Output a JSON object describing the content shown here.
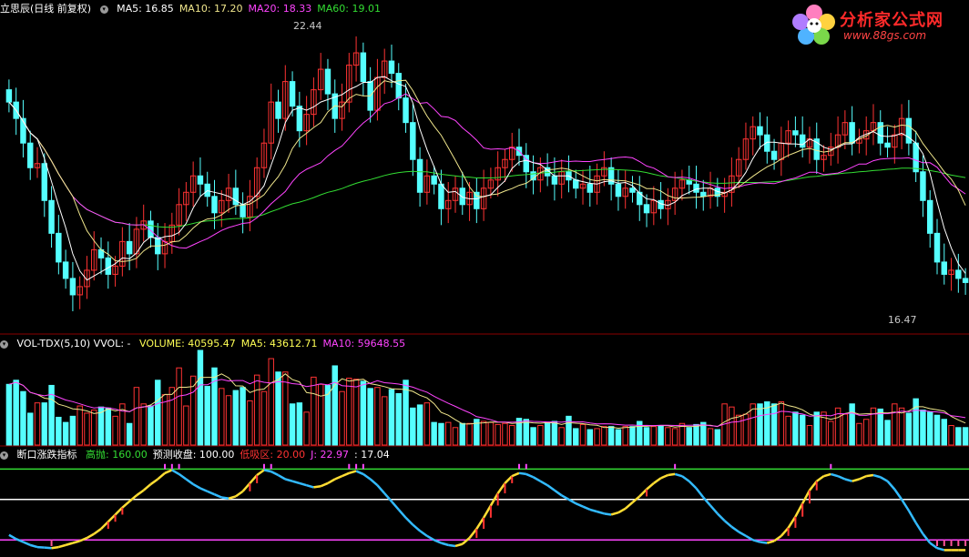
{
  "price_panel": {
    "title": "立思辰(日线 前复权)",
    "indicators": [
      {
        "label": "MA5: 16.85",
        "color": "#ffffff"
      },
      {
        "label": "MA10: 17.20",
        "color": "#f0e68c"
      },
      {
        "label": "MA20: 18.33",
        "color": "#ff44ff"
      },
      {
        "label": "MA60: 19.01",
        "color": "#33dd33"
      }
    ],
    "high_label": "22.44",
    "low_label": "16.47"
  },
  "volume_panel": {
    "title": "VOL-TDX(5,10) VVOL: -",
    "indicators": [
      {
        "label": "VOLUME: 40595.47",
        "color": "#ffff55"
      },
      {
        "label": "MA5: 43612.71",
        "color": "#ffff55"
      },
      {
        "label": "MA10: 59648.55",
        "color": "#ff44ff"
      }
    ]
  },
  "oscillator_panel": {
    "title": "断口涨跌指标",
    "indicators": [
      {
        "label": "高抛: 160.00",
        "color": "#33dd33"
      },
      {
        "label": "预测收盘: 100.00",
        "color": "#ffffff"
      },
      {
        "label": "低吸区: 20.00",
        "color": "#ff3333"
      },
      {
        "label": "J: 22.97",
        "color": "#ff44ff"
      },
      {
        "label": ": 17.04",
        "color": "#ffffff"
      }
    ]
  },
  "logo": {
    "brand": "分析家公式网",
    "url": "www.88gs.com"
  },
  "colors": {
    "up": "#ff3333",
    "down": "#55ffff",
    "ma5": "#ffffff",
    "ma10": "#f0e68c",
    "ma20": "#ff44ff",
    "ma60": "#33dd33",
    "divider": "#8b0000"
  },
  "chart_data": {
    "type": "candlestick",
    "closes": [
      21.0,
      20.6,
      20.0,
      19.4,
      19.5,
      18.6,
      17.8,
      17.1,
      16.7,
      16.3,
      16.5,
      16.9,
      17.4,
      17.2,
      16.8,
      17.0,
      17.6,
      17.3,
      17.9,
      18.1,
      17.7,
      17.3,
      17.6,
      18.0,
      18.5,
      18.8,
      19.2,
      19.0,
      18.7,
      18.3,
      18.6,
      18.9,
      18.5,
      18.2,
      18.7,
      19.4,
      20.0,
      21.0,
      20.6,
      21.5,
      20.9,
      20.3,
      20.7,
      21.3,
      21.8,
      21.2,
      20.6,
      21.0,
      21.9,
      22.2,
      21.5,
      20.8,
      21.6,
      22.0,
      21.7,
      21.1,
      20.5,
      19.6,
      18.8,
      19.2,
      19.0,
      18.4,
      18.6,
      18.9,
      18.5,
      18.8,
      18.4,
      18.9,
      19.1,
      19.4,
      19.6,
      19.9,
      19.7,
      19.3,
      19.1,
      19.4,
      19.2,
      19.0,
      19.3,
      19.1,
      18.9,
      19.0,
      18.8,
      19.2,
      19.4,
      19.0,
      18.7,
      18.9,
      18.8,
      18.5,
      18.3,
      18.6,
      18.4,
      18.6,
      18.9,
      19.1,
      19.0,
      18.8,
      18.7,
      18.9,
      18.7,
      18.8,
      19.2,
      19.6,
      20.1,
      20.4,
      20.2,
      19.8,
      19.6,
      20.0,
      20.3,
      20.2,
      19.9,
      20.1,
      19.6,
      19.7,
      19.9,
      20.2,
      20.5,
      20.0,
      20.1,
      20.3,
      20.5,
      20.0,
      19.9,
      20.2,
      20.6,
      20.0,
      19.3,
      18.6,
      17.8,
      17.1,
      16.8,
      16.9,
      16.7,
      16.6
    ],
    "ma5": [
      21.0,
      20.8,
      20.53,
      20.25,
      20.1,
      19.62,
      19.06,
      18.48,
      17.94,
      17.3,
      16.88,
      16.66,
      16.76,
      16.86,
      16.96,
      17.06,
      17.2,
      17.18,
      17.32,
      17.58,
      17.72,
      17.66,
      17.72,
      17.74,
      17.82,
      18.04,
      18.42,
      18.7,
      18.84,
      18.8,
      18.76,
      18.7,
      18.6,
      18.5,
      18.58,
      18.74,
      18.96,
      19.46,
      19.94,
      20.5,
      20.8,
      20.86,
      20.8,
      20.88,
      21.0,
      21.06,
      21.12,
      21.18,
      21.3,
      21.38,
      21.48,
      21.48,
      21.6,
      21.62,
      21.52,
      21.44,
      21.38,
      20.98,
      20.34,
      19.84,
      19.42,
      19.0,
      18.8,
      18.82,
      18.68,
      18.64,
      18.64,
      18.7,
      18.74,
      18.92,
      19.08,
      19.38,
      19.54,
      19.58,
      19.52,
      19.48,
      19.34,
      19.2,
      19.2,
      19.2,
      19.1,
      19.06,
      19.02,
      19.0,
      19.06,
      19.08,
      19.02,
      19.04,
      18.96,
      18.78,
      18.64,
      18.62,
      18.52,
      18.48,
      18.56,
      18.72,
      18.8,
      18.88,
      18.9,
      18.9,
      18.82,
      18.78,
      18.86,
      19.04,
      19.28,
      19.62,
      19.9,
      20.02,
      20.02,
      20.0,
      19.98,
      19.98,
      19.96,
      20.1,
      20.02,
      19.9,
      19.84,
      19.9,
      19.98,
      19.98,
      20.14,
      20.22,
      20.28,
      20.18,
      20.16,
      20.18,
      20.24,
      20.14,
      20.0,
      19.74,
      19.26,
      18.56,
      17.92,
      17.44,
      17.06,
      16.82
    ],
    "ma10": [
      21.0,
      20.8,
      20.53,
      20.25,
      20.1,
      19.85,
      19.56,
      19.25,
      18.97,
      18.7,
      18.25,
      17.86,
      17.62,
      17.4,
      17.29,
      17.13,
      17.11,
      17.13,
      17.19,
      17.37,
      17.49,
      17.49,
      17.51,
      17.59,
      17.61,
      17.75,
      17.93,
      18.07,
      18.15,
      18.17,
      18.25,
      18.38,
      18.47,
      18.49,
      18.51,
      18.62,
      18.74,
      18.97,
      19.18,
      19.47,
      19.87,
      20.11,
      20.24,
      20.38,
      20.5,
      20.76,
      20.91,
      20.88,
      21.09,
      21.19,
      21.15,
      21.15,
      21.37,
      21.52,
      21.48,
      21.52,
      21.53,
      21.28,
      20.96,
      20.66,
      20.41,
      20.19,
      19.89,
      19.58,
      19.26,
      18.93,
      18.71,
      18.69,
      18.74,
      18.76,
      18.83,
      18.89,
      18.97,
      19.02,
      19.14,
      19.28,
      19.35,
      19.36,
      19.39,
      19.36,
      19.29,
      19.2,
      19.11,
      19.08,
      19.11,
      19.1,
      19.09,
      19.08,
      19.03,
      18.98,
      18.89,
      18.89,
      18.83,
      18.72,
      18.66,
      18.66,
      18.67,
      18.68,
      18.69,
      18.73,
      18.73,
      18.78,
      18.86,
      18.94,
      19.06,
      19.19,
      19.31,
      19.42,
      19.5,
      19.61,
      19.7,
      19.77,
      19.84,
      19.87,
      19.82,
      19.78,
      19.81,
      19.93,
      20.01,
      20.01,
      20.1,
      20.17,
      20.3,
      20.4,
      20.43,
      20.39,
      20.44,
      20.42,
      20.27,
      19.99,
      19.76,
      19.54,
      19.3,
      19.12,
      18.85,
      18.48
    ],
    "ma20": [
      21.0,
      20.8,
      20.53,
      20.25,
      20.1,
      19.85,
      19.56,
      19.25,
      18.97,
      18.7,
      18.52,
      18.38,
      18.3,
      18.22,
      18.14,
      18.07,
      18.05,
      18.01,
      18.0,
      18.01,
      17.87,
      17.71,
      17.59,
      17.5,
      17.45,
      17.44,
      17.52,
      17.6,
      17.67,
      17.77,
      17.87,
      17.94,
      17.99,
      18.04,
      18.06,
      18.18,
      18.34,
      18.52,
      18.67,
      18.82,
      19.06,
      19.25,
      19.36,
      19.44,
      19.52,
      19.69,
      19.82,
      19.93,
      20.12,
      20.32,
      20.49,
      20.62,
      20.8,
      20.96,
      21.01,
      21.11,
      21.2,
      21.08,
      20.97,
      20.99,
      20.83,
      20.65,
      20.63,
      20.55,
      20.37,
      20.23,
      20.07,
      19.88,
      19.85,
      19.86,
      19.85,
      19.89,
      19.81,
      19.6,
      19.52,
      19.5,
      19.51,
      19.54,
      19.57,
      19.55,
      19.56,
      19.55,
      19.55,
      19.58,
      19.6,
      19.62,
      19.65,
      19.66,
      19.64,
      19.55,
      19.44,
      19.39,
      19.29,
      19.18,
      19.16,
      19.17,
      19.15,
      19.09,
      19.04,
      18.99,
      18.93,
      18.89,
      18.91,
      18.93,
      18.98,
      19.01,
      19.03,
      19.02,
      19.01,
      19.06,
      19.11,
      19.15,
      19.22,
      19.29,
      19.29,
      19.23,
      19.25,
      19.27,
      19.33,
      19.41,
      19.49,
      19.49,
      19.57,
      19.61,
      19.62,
      19.63,
      19.63,
      19.64,
      19.58,
      19.52,
      19.52,
      19.41,
      19.2,
      18.99,
      18.88,
      18.76
    ],
    "ma60": [
      21.0,
      20.8,
      20.53,
      20.25,
      20.1,
      19.85,
      19.56,
      19.25,
      18.97,
      18.7,
      18.52,
      18.38,
      18.3,
      18.22,
      18.14,
      18.07,
      18.05,
      18.01,
      18.0,
      18.01,
      17.99,
      17.96,
      17.95,
      17.95,
      17.97,
      18.0,
      18.04,
      18.08,
      18.1,
      18.11,
      18.13,
      18.15,
      18.16,
      18.16,
      18.18,
      18.21,
      18.26,
      18.33,
      18.39,
      18.46,
      18.52,
      18.56,
      18.61,
      18.67,
      18.74,
      18.8,
      18.84,
      18.89,
      18.96,
      19.02,
      19.07,
      19.11,
      19.16,
      19.21,
      19.25,
      19.28,
      19.3,
      19.31,
      19.3,
      19.3,
      19.27,
      19.24,
      19.22,
      19.2,
      19.18,
      19.17,
      19.15,
      19.15,
      19.15,
      19.16,
      19.18,
      19.2,
      19.22,
      19.23,
      19.25,
      19.27,
      19.28,
      19.29,
      19.31,
      19.32,
      19.32,
      19.33,
      19.34,
      19.35,
      19.36,
      19.36,
      19.35,
      19.34,
      19.33,
      19.31,
      19.28,
      19.24,
      19.2,
      19.18,
      19.16,
      19.13,
      19.1,
      19.07,
      19.05,
      19.03,
      19.02,
      19.02,
      19.03,
      19.04,
      19.04,
      19.04,
      19.04,
      19.05,
      19.06,
      19.07,
      19.09,
      19.12,
      19.15,
      19.18,
      19.19,
      19.21,
      19.23,
      19.25,
      19.27,
      19.28,
      19.3,
      19.31,
      19.33,
      19.34,
      19.36,
      19.37,
      19.39,
      19.39,
      19.38,
      19.36,
      19.33,
      19.3,
      19.26,
      19.22,
      19.19,
      19.16
    ],
    "volume": [
      59,
      63,
      52,
      31,
      41,
      41,
      58,
      27,
      22,
      28,
      38,
      31,
      34,
      37,
      36,
      28,
      40,
      21,
      56,
      40,
      38,
      63,
      49,
      56,
      75,
      38,
      67,
      92,
      57,
      75,
      55,
      48,
      53,
      56,
      43,
      68,
      52,
      84,
      71,
      71,
      40,
      41,
      32,
      66,
      59,
      58,
      77,
      52,
      65,
      64,
      62,
      55,
      56,
      47,
      54,
      50,
      63,
      36,
      39,
      41,
      22,
      21,
      22,
      17,
      21,
      21,
      25,
      23,
      22,
      20,
      21,
      19,
      26,
      25,
      17,
      19,
      22,
      23,
      17,
      28,
      16,
      20,
      15,
      16,
      18,
      18,
      15,
      18,
      18,
      23,
      17,
      18,
      19,
      17,
      16,
      21,
      17,
      20,
      22,
      16,
      15,
      40,
      37,
      29,
      30,
      40,
      40,
      42,
      40,
      42,
      28,
      32,
      29,
      19,
      32,
      32,
      23,
      36,
      30,
      40,
      21,
      25,
      36,
      35,
      24,
      40,
      36,
      31,
      45,
      34,
      32,
      29,
      25,
      19,
      17,
      17
    ],
    "vol_ma5": [
      59,
      61.0,
      58.0,
      51.25,
      49.2,
      45.6,
      44.6,
      39.6,
      37.8,
      35.2,
      34.6,
      33.2,
      30.6,
      31.6,
      35.2,
      33.2,
      34.6,
      32.4,
      36.2,
      37.0,
      39.0,
      43.6,
      49.2,
      49.2,
      56.2,
      56.2,
      57.0,
      65.6,
      65.8,
      65.8,
      69.2,
      65.4,
      57.6,
      57.4,
      51.0,
      53.6,
      54.4,
      60.6,
      63.6,
      69.2,
      63.6,
      61.4,
      51.0,
      50.0,
      47.6,
      49.2,
      58.4,
      64.4,
      62.2,
      63.2,
      64.0,
      59.6,
      58.4,
      56.8,
      54.8,
      54.4,
      54.0,
      52.2,
      48.4,
      45.8,
      40.2,
      31.8,
      29.0,
      24.6,
      20.6,
      20.4,
      21.2,
      21.6,
      22.4,
      22.2,
      22.2,
      21.0,
      21.6,
      22.2,
      21.6,
      21.2,
      21.8,
      21.6,
      20.0,
      21.8,
      21.2,
      20.8,
      19.6,
      19.2,
      17.0,
      17.4,
      16.4,
      17.0,
      17.4,
      18.4,
      18.2,
      18.8,
      19.0,
      18.8,
      17.4,
      18.2,
      18.0,
      18.2,
      19.2,
      19.2,
      18.0,
      22.6,
      26.0,
      27.4,
      30.2,
      35.2,
      35.2,
      36.2,
      38.4,
      40.8,
      38.4,
      36.8,
      34.2,
      30.0,
      28.0,
      26.8,
      25.0,
      26.8,
      30.6,
      32.0,
      30.0,
      30.4,
      30.4,
      31.4,
      31.2,
      32.0,
      31.2,
      33.2,
      37.2,
      37.2,
      35.4,
      34.2,
      33.0,
      27.8,
      24.4,
      21.4
    ],
    "vol_ma10": [
      59,
      61.0,
      58.0,
      51.25,
      49.2,
      47.83,
      49.29,
      46.5,
      43.78,
      42.2,
      40.1,
      37.9,
      36.1,
      36.7,
      36.2,
      34.9,
      33.1,
      32.5,
      36.0,
      37.2,
      37.2,
      40.4,
      41.9,
      43.8,
      47.7,
      48.7,
      51.4,
      58.5,
      58.6,
      62.1,
      63.8,
      62.3,
      62.7,
      62.7,
      59.5,
      62.5,
      61.0,
      60.2,
      61.6,
      61.2,
      59.7,
      59.0,
      56.9,
      57.9,
      59.5,
      58.5,
      61.0,
      57.8,
      57.2,
      56.5,
      58.7,
      60.1,
      62.5,
      60.6,
      60.1,
      59.3,
      57.9,
      56.3,
      53.7,
      51.4,
      47.4,
      44.0,
      40.6,
      37.6,
      34.3,
      31.4,
      27.6,
      26.3,
      24.6,
      22.5,
      22.4,
      22.2,
      22.6,
      23.4,
      23.0,
      22.8,
      22.5,
      22.5,
      22.2,
      23.0,
      22.5,
      22.6,
      21.5,
      20.6,
      20.7,
      20.6,
      19.9,
      19.4,
      19.5,
      19.0,
      19.1,
      18.9,
      19.3,
      19.2,
      19.0,
      19.1,
      19.2,
      19.4,
      19.7,
      18.8,
      18.2,
      20.4,
      22.2,
      22.8,
      24.7,
      26.6,
      28.5,
      29.7,
      30.5,
      32.8,
      32.4,
      31.2,
      30.2,
      28.0,
      28.4,
      29.0,
      28.4,
      30.5,
      30.4,
      31.2,
      29.0,
      28.8,
      30.2,
      30.4,
      30.5,
      31.4,
      32.9,
      32.4,
      34.0,
      33.4,
      32.6,
      32.2,
      31.2,
      28.6,
      27.8,
      26.6
    ],
    "oscillator": [
      30,
      22,
      16,
      10,
      6,
      5,
      4,
      6,
      10,
      14,
      18,
      24,
      32,
      42,
      56,
      70,
      84,
      96,
      108,
      118,
      130,
      140,
      152,
      158,
      150,
      140,
      130,
      122,
      116,
      110,
      104,
      102,
      106,
      116,
      132,
      148,
      158,
      155,
      148,
      140,
      136,
      132,
      128,
      124,
      126,
      132,
      140,
      146,
      152,
      156,
      150,
      140,
      128,
      112,
      96,
      80,
      64,
      50,
      38,
      28,
      20,
      14,
      10,
      8,
      12,
      24,
      42,
      64,
      88,
      112,
      132,
      146,
      152,
      150,
      144,
      136,
      128,
      118,
      108,
      100,
      92,
      86,
      80,
      76,
      72,
      70,
      74,
      82,
      94,
      106,
      120,
      132,
      142,
      148,
      150,
      146,
      136,
      122,
      104,
      88,
      72,
      58,
      46,
      36,
      28,
      20,
      16,
      14,
      18,
      28,
      44,
      66,
      92,
      118,
      136,
      146,
      150,
      146,
      140,
      136,
      140,
      146,
      148,
      144,
      136,
      120,
      100,
      78,
      54,
      32,
      14,
      4,
      0,
      0,
      0,
      0
    ],
    "osc_levels": {
      "high": 160,
      "mid": 100,
      "low": 20
    },
    "price_range": [
      15.5,
      23.0
    ],
    "osc_range": [
      -10,
      175
    ]
  }
}
